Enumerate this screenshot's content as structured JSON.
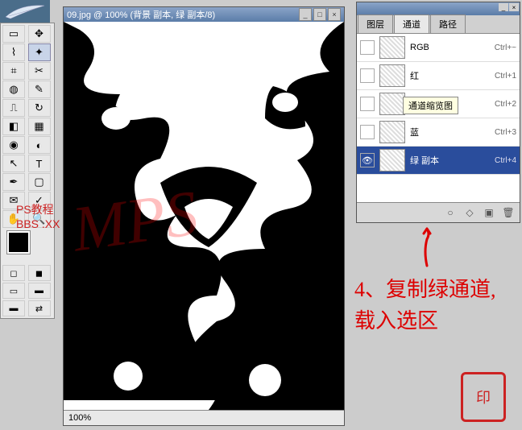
{
  "feather_icon": "feather",
  "doc": {
    "title": "09.jpg @ 100% (背景 副本, 绿 副本/8)",
    "zoom": "100%"
  },
  "watermark": "MPS",
  "watermark2_a": "PS教程",
  "watermark2_b": "BBS   .XX",
  "panel": {
    "tabs": [
      "图层",
      "通道",
      "路径"
    ],
    "active_tab": 1,
    "channels": [
      {
        "name": "RGB",
        "shortcut": "Ctrl+~",
        "visible": false,
        "selected": false
      },
      {
        "name": "红",
        "shortcut": "Ctrl+1",
        "visible": false,
        "selected": false
      },
      {
        "name": "",
        "shortcut": "Ctrl+2",
        "visible": false,
        "selected": false,
        "tooltip": "通道缩览图"
      },
      {
        "name": "蓝",
        "shortcut": "Ctrl+3",
        "visible": false,
        "selected": false
      },
      {
        "name": "绿 副本",
        "shortcut": "Ctrl+4",
        "visible": true,
        "selected": true
      }
    ],
    "tooltip": "通道缩览图"
  },
  "annotation": "4、复制绿通道,载入选区",
  "seal": "印"
}
